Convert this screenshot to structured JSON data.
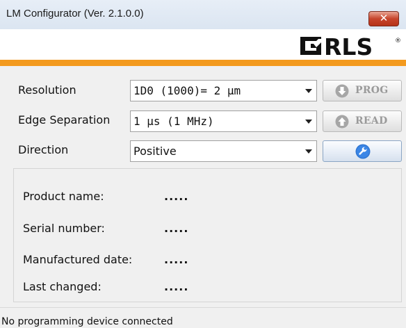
{
  "window": {
    "title": "LM Configurator (Ver. 2.1.0.0)",
    "close_glyph": "✕"
  },
  "logo": {
    "text": "RLS",
    "registered": "®",
    "icon": "rls-logo-icon"
  },
  "colors": {
    "accent_orange": "#f39a1e",
    "window_bg": "#f0f0f0",
    "close_red": "#c7452c",
    "icon_gray": "#a6a6a6",
    "icon_blue": "#2f76d2"
  },
  "settings": {
    "resolution": {
      "label": "Resolution",
      "value": "1D0 (1000)= 2 µm"
    },
    "edge_separation": {
      "label": "Edge Separation",
      "value": "1 µs (1 MHz)"
    },
    "direction": {
      "label": "Direction",
      "value": "Positive"
    }
  },
  "buttons": {
    "prog": {
      "label": "PROG",
      "icon": "arrow-down-circle-icon",
      "enabled": false
    },
    "read": {
      "label": "READ",
      "icon": "arrow-up-circle-icon",
      "enabled": false
    },
    "settings": {
      "icon": "wrench-icon",
      "enabled": true
    }
  },
  "info": {
    "product_name": {
      "label": "Product name:",
      "value": "....."
    },
    "serial_number": {
      "label": "Serial number:",
      "value": "....."
    },
    "manufactured_date": {
      "label": "Manufactured date:",
      "value": "....."
    },
    "last_changed": {
      "label": "Last changed:",
      "value": "....."
    }
  },
  "status": {
    "text": "No programming device connected"
  }
}
